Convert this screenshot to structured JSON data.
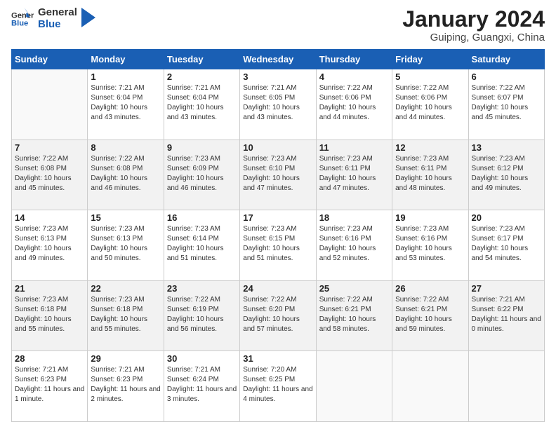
{
  "header": {
    "logo_general": "General",
    "logo_blue": "Blue",
    "main_title": "January 2024",
    "subtitle": "Guiping, Guangxi, China"
  },
  "columns": [
    "Sunday",
    "Monday",
    "Tuesday",
    "Wednesday",
    "Thursday",
    "Friday",
    "Saturday"
  ],
  "weeks": [
    [
      {
        "day": "",
        "sunrise": "",
        "sunset": "",
        "daylight": ""
      },
      {
        "day": "1",
        "sunrise": "Sunrise: 7:21 AM",
        "sunset": "Sunset: 6:04 PM",
        "daylight": "Daylight: 10 hours and 43 minutes."
      },
      {
        "day": "2",
        "sunrise": "Sunrise: 7:21 AM",
        "sunset": "Sunset: 6:04 PM",
        "daylight": "Daylight: 10 hours and 43 minutes."
      },
      {
        "day": "3",
        "sunrise": "Sunrise: 7:21 AM",
        "sunset": "Sunset: 6:05 PM",
        "daylight": "Daylight: 10 hours and 43 minutes."
      },
      {
        "day": "4",
        "sunrise": "Sunrise: 7:22 AM",
        "sunset": "Sunset: 6:06 PM",
        "daylight": "Daylight: 10 hours and 44 minutes."
      },
      {
        "day": "5",
        "sunrise": "Sunrise: 7:22 AM",
        "sunset": "Sunset: 6:06 PM",
        "daylight": "Daylight: 10 hours and 44 minutes."
      },
      {
        "day": "6",
        "sunrise": "Sunrise: 7:22 AM",
        "sunset": "Sunset: 6:07 PM",
        "daylight": "Daylight: 10 hours and 45 minutes."
      }
    ],
    [
      {
        "day": "7",
        "sunrise": "Sunrise: 7:22 AM",
        "sunset": "Sunset: 6:08 PM",
        "daylight": "Daylight: 10 hours and 45 minutes."
      },
      {
        "day": "8",
        "sunrise": "Sunrise: 7:22 AM",
        "sunset": "Sunset: 6:08 PM",
        "daylight": "Daylight: 10 hours and 46 minutes."
      },
      {
        "day": "9",
        "sunrise": "Sunrise: 7:23 AM",
        "sunset": "Sunset: 6:09 PM",
        "daylight": "Daylight: 10 hours and 46 minutes."
      },
      {
        "day": "10",
        "sunrise": "Sunrise: 7:23 AM",
        "sunset": "Sunset: 6:10 PM",
        "daylight": "Daylight: 10 hours and 47 minutes."
      },
      {
        "day": "11",
        "sunrise": "Sunrise: 7:23 AM",
        "sunset": "Sunset: 6:11 PM",
        "daylight": "Daylight: 10 hours and 47 minutes."
      },
      {
        "day": "12",
        "sunrise": "Sunrise: 7:23 AM",
        "sunset": "Sunset: 6:11 PM",
        "daylight": "Daylight: 10 hours and 48 minutes."
      },
      {
        "day": "13",
        "sunrise": "Sunrise: 7:23 AM",
        "sunset": "Sunset: 6:12 PM",
        "daylight": "Daylight: 10 hours and 49 minutes."
      }
    ],
    [
      {
        "day": "14",
        "sunrise": "Sunrise: 7:23 AM",
        "sunset": "Sunset: 6:13 PM",
        "daylight": "Daylight: 10 hours and 49 minutes."
      },
      {
        "day": "15",
        "sunrise": "Sunrise: 7:23 AM",
        "sunset": "Sunset: 6:13 PM",
        "daylight": "Daylight: 10 hours and 50 minutes."
      },
      {
        "day": "16",
        "sunrise": "Sunrise: 7:23 AM",
        "sunset": "Sunset: 6:14 PM",
        "daylight": "Daylight: 10 hours and 51 minutes."
      },
      {
        "day": "17",
        "sunrise": "Sunrise: 7:23 AM",
        "sunset": "Sunset: 6:15 PM",
        "daylight": "Daylight: 10 hours and 51 minutes."
      },
      {
        "day": "18",
        "sunrise": "Sunrise: 7:23 AM",
        "sunset": "Sunset: 6:16 PM",
        "daylight": "Daylight: 10 hours and 52 minutes."
      },
      {
        "day": "19",
        "sunrise": "Sunrise: 7:23 AM",
        "sunset": "Sunset: 6:16 PM",
        "daylight": "Daylight: 10 hours and 53 minutes."
      },
      {
        "day": "20",
        "sunrise": "Sunrise: 7:23 AM",
        "sunset": "Sunset: 6:17 PM",
        "daylight": "Daylight: 10 hours and 54 minutes."
      }
    ],
    [
      {
        "day": "21",
        "sunrise": "Sunrise: 7:23 AM",
        "sunset": "Sunset: 6:18 PM",
        "daylight": "Daylight: 10 hours and 55 minutes."
      },
      {
        "day": "22",
        "sunrise": "Sunrise: 7:23 AM",
        "sunset": "Sunset: 6:18 PM",
        "daylight": "Daylight: 10 hours and 55 minutes."
      },
      {
        "day": "23",
        "sunrise": "Sunrise: 7:22 AM",
        "sunset": "Sunset: 6:19 PM",
        "daylight": "Daylight: 10 hours and 56 minutes."
      },
      {
        "day": "24",
        "sunrise": "Sunrise: 7:22 AM",
        "sunset": "Sunset: 6:20 PM",
        "daylight": "Daylight: 10 hours and 57 minutes."
      },
      {
        "day": "25",
        "sunrise": "Sunrise: 7:22 AM",
        "sunset": "Sunset: 6:21 PM",
        "daylight": "Daylight: 10 hours and 58 minutes."
      },
      {
        "day": "26",
        "sunrise": "Sunrise: 7:22 AM",
        "sunset": "Sunset: 6:21 PM",
        "daylight": "Daylight: 10 hours and 59 minutes."
      },
      {
        "day": "27",
        "sunrise": "Sunrise: 7:21 AM",
        "sunset": "Sunset: 6:22 PM",
        "daylight": "Daylight: 11 hours and 0 minutes."
      }
    ],
    [
      {
        "day": "28",
        "sunrise": "Sunrise: 7:21 AM",
        "sunset": "Sunset: 6:23 PM",
        "daylight": "Daylight: 11 hours and 1 minute."
      },
      {
        "day": "29",
        "sunrise": "Sunrise: 7:21 AM",
        "sunset": "Sunset: 6:23 PM",
        "daylight": "Daylight: 11 hours and 2 minutes."
      },
      {
        "day": "30",
        "sunrise": "Sunrise: 7:21 AM",
        "sunset": "Sunset: 6:24 PM",
        "daylight": "Daylight: 11 hours and 3 minutes."
      },
      {
        "day": "31",
        "sunrise": "Sunrise: 7:20 AM",
        "sunset": "Sunset: 6:25 PM",
        "daylight": "Daylight: 11 hours and 4 minutes."
      },
      {
        "day": "",
        "sunrise": "",
        "sunset": "",
        "daylight": ""
      },
      {
        "day": "",
        "sunrise": "",
        "sunset": "",
        "daylight": ""
      },
      {
        "day": "",
        "sunrise": "",
        "sunset": "",
        "daylight": ""
      }
    ]
  ]
}
